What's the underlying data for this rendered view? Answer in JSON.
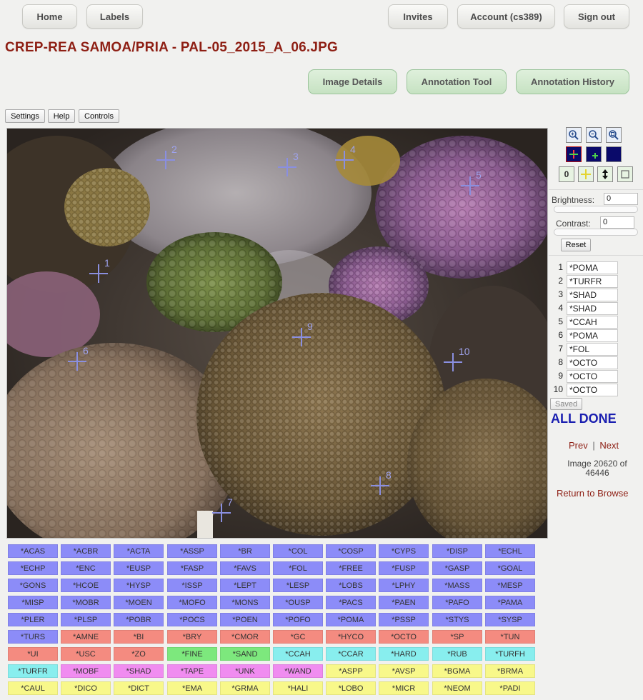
{
  "nav": {
    "home": "Home",
    "labels": "Labels",
    "invites": "Invites",
    "account": "Account (cs389)",
    "signout": "Sign out"
  },
  "page_title": "CREP-REA SAMOA/PRIA - PAL-05_2015_A_06.JPG",
  "tabs": {
    "image_details": "Image Details",
    "annotation_tool": "Annotation Tool",
    "annotation_history": "Annotation History"
  },
  "toolbar": {
    "settings": "Settings",
    "help": "Help",
    "controls": "Controls"
  },
  "point_markers": [
    "1",
    "2",
    "3",
    "4",
    "5",
    "6",
    "7",
    "8",
    "9",
    "10"
  ],
  "tools": {
    "zoom_in": "zoom-in-icon",
    "zoom_out": "zoom-out-icon",
    "zoom_fit": "zoom-fit-icon",
    "count_label": "0"
  },
  "brightness": {
    "label": "Brightness:",
    "value": "0"
  },
  "contrast": {
    "label": "Contrast:",
    "value": "0"
  },
  "reset_label": "Reset",
  "points": [
    {
      "num": "1",
      "label": "*POMA"
    },
    {
      "num": "2",
      "label": "*TURFR"
    },
    {
      "num": "3",
      "label": "*SHAD"
    },
    {
      "num": "4",
      "label": "*SHAD"
    },
    {
      "num": "5",
      "label": "*CCAH"
    },
    {
      "num": "6",
      "label": "*POMA"
    },
    {
      "num": "7",
      "label": "*FOL"
    },
    {
      "num": "8",
      "label": "*OCTO"
    },
    {
      "num": "9",
      "label": "*OCTO"
    },
    {
      "num": "10",
      "label": "*OCTO"
    }
  ],
  "saved_label": "Saved",
  "status": "ALL DONE",
  "pager": {
    "prev": "Prev",
    "sep": "|",
    "next": "Next"
  },
  "image_position": "Image 20620 of 46446",
  "return_link": "Return to Browse",
  "label_buttons": [
    [
      "*ACAS",
      "*ACBR",
      "*ACTA",
      "*ASSP",
      "*BR",
      "*COL",
      "*COSP",
      "*CYPS",
      "*DISP",
      "*ECHL"
    ],
    [
      "*ECHP",
      "*ENC",
      "*EUSP",
      "*FASP",
      "*FAVS",
      "*FOL",
      "*FREE",
      "*FUSP",
      "*GASP",
      "*GOAL"
    ],
    [
      "*GONS",
      "*HCOE",
      "*HYSP",
      "*ISSP",
      "*LEPT",
      "*LESP",
      "*LOBS",
      "*LPHY",
      "*MASS",
      "*MESP"
    ],
    [
      "*MISP",
      "*MOBR",
      "*MOEN",
      "*MOFO",
      "*MONS",
      "*OUSP",
      "*PACS",
      "*PAEN",
      "*PAFO",
      "*PAMA"
    ],
    [
      "*PLER",
      "*PLSP",
      "*POBR",
      "*POCS",
      "*POEN",
      "*POFO",
      "*POMA",
      "*PSSP",
      "*STYS",
      "*SYSP"
    ],
    [
      "*TURS",
      "*AMNE",
      "*BI",
      "*BRY",
      "*CMOR",
      "*GC",
      "*HYCO",
      "*OCTO",
      "*SP",
      "*TUN"
    ],
    [
      "*UI",
      "*USC",
      "*ZO",
      "*FINE",
      "*SAND",
      "*CCAH",
      "*CCAR",
      "*HARD",
      "*RUB",
      "*TURFH"
    ],
    [
      "*TURFR",
      "*MOBF",
      "*SHAD",
      "*TAPE",
      "*UNK",
      "*WAND",
      "*ASPP",
      "*AVSP",
      "*BGMA",
      "*BRMA"
    ],
    [
      "*CAUL",
      "*DICO",
      "*DICT",
      "*EMA",
      "*GRMA",
      "*HALI",
      "*LOBO",
      "*MICR",
      "*NEOM",
      "*PADI"
    ]
  ],
  "label_colors": [
    [
      "#8c8cf8",
      "#8c8cf8",
      "#8c8cf8",
      "#8c8cf8",
      "#8c8cf8",
      "#8c8cf8",
      "#8c8cf8",
      "#8c8cf8",
      "#8c8cf8",
      "#8c8cf8"
    ],
    [
      "#8c8cf8",
      "#8c8cf8",
      "#8c8cf8",
      "#8c8cf8",
      "#8c8cf8",
      "#8c8cf8",
      "#8c8cf8",
      "#8c8cf8",
      "#8c8cf8",
      "#8c8cf8"
    ],
    [
      "#8c8cf8",
      "#8c8cf8",
      "#8c8cf8",
      "#8c8cf8",
      "#8c8cf8",
      "#8c8cf8",
      "#8c8cf8",
      "#8c8cf8",
      "#8c8cf8",
      "#8c8cf8"
    ],
    [
      "#8c8cf8",
      "#8c8cf8",
      "#8c8cf8",
      "#8c8cf8",
      "#8c8cf8",
      "#8c8cf8",
      "#8c8cf8",
      "#8c8cf8",
      "#8c8cf8",
      "#8c8cf8"
    ],
    [
      "#8c8cf8",
      "#8c8cf8",
      "#8c8cf8",
      "#8c8cf8",
      "#8c8cf8",
      "#8c8cf8",
      "#8c8cf8",
      "#8c8cf8",
      "#8c8cf8",
      "#8c8cf8"
    ],
    [
      "#8c8cf8",
      "#f48b80",
      "#f48b80",
      "#f48b80",
      "#f48b80",
      "#f48b80",
      "#f48b80",
      "#f48b80",
      "#f48b80",
      "#f48b80"
    ],
    [
      "#f48b80",
      "#f48b80",
      "#f48b80",
      "#7de87d",
      "#7de87d",
      "#88eeee",
      "#88eeee",
      "#88eeee",
      "#88eeee",
      "#88eeee"
    ],
    [
      "#88eeee",
      "#f08cf0",
      "#f08cf0",
      "#f08cf0",
      "#f08cf0",
      "#f08cf0",
      "#f8f88a",
      "#f8f88a",
      "#f8f88a",
      "#f8f88a"
    ],
    [
      "#f8f88a",
      "#f8f88a",
      "#f8f88a",
      "#f8f88a",
      "#f8f88a",
      "#f8f88a",
      "#f8f88a",
      "#f8f88a",
      "#f8f88a",
      "#f8f88a"
    ]
  ],
  "colors": {
    "title": "#8e1f14",
    "status": "#1a1fb0",
    "link": "#8e1f14"
  }
}
